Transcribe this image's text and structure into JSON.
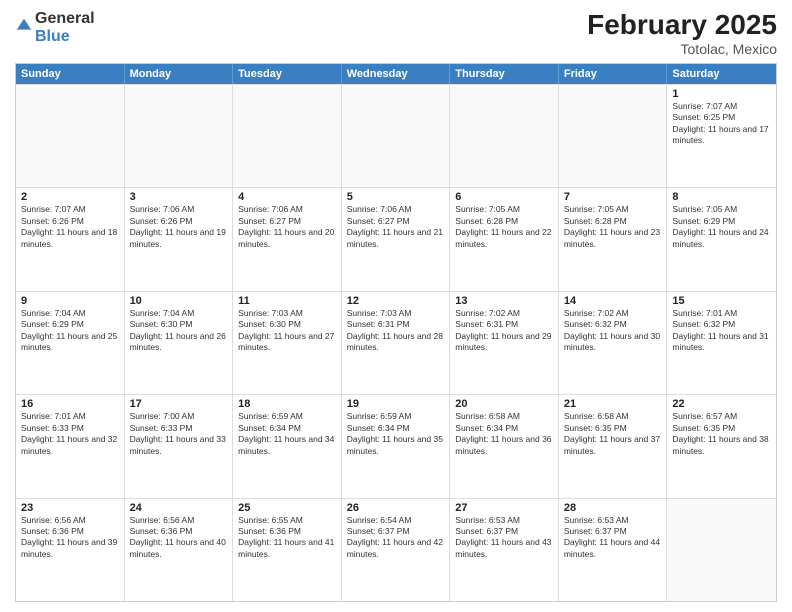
{
  "header": {
    "logo_general": "General",
    "logo_blue": "Blue",
    "month_title": "February 2025",
    "location": "Totolac, Mexico"
  },
  "weekdays": [
    "Sunday",
    "Monday",
    "Tuesday",
    "Wednesday",
    "Thursday",
    "Friday",
    "Saturday"
  ],
  "rows": [
    [
      {
        "day": "",
        "info": ""
      },
      {
        "day": "",
        "info": ""
      },
      {
        "day": "",
        "info": ""
      },
      {
        "day": "",
        "info": ""
      },
      {
        "day": "",
        "info": ""
      },
      {
        "day": "",
        "info": ""
      },
      {
        "day": "1",
        "info": "Sunrise: 7:07 AM\nSunset: 6:25 PM\nDaylight: 11 hours and 17 minutes."
      }
    ],
    [
      {
        "day": "2",
        "info": "Sunrise: 7:07 AM\nSunset: 6:26 PM\nDaylight: 11 hours and 18 minutes."
      },
      {
        "day": "3",
        "info": "Sunrise: 7:06 AM\nSunset: 6:26 PM\nDaylight: 11 hours and 19 minutes."
      },
      {
        "day": "4",
        "info": "Sunrise: 7:06 AM\nSunset: 6:27 PM\nDaylight: 11 hours and 20 minutes."
      },
      {
        "day": "5",
        "info": "Sunrise: 7:06 AM\nSunset: 6:27 PM\nDaylight: 11 hours and 21 minutes."
      },
      {
        "day": "6",
        "info": "Sunrise: 7:05 AM\nSunset: 6:28 PM\nDaylight: 11 hours and 22 minutes."
      },
      {
        "day": "7",
        "info": "Sunrise: 7:05 AM\nSunset: 6:28 PM\nDaylight: 11 hours and 23 minutes."
      },
      {
        "day": "8",
        "info": "Sunrise: 7:05 AM\nSunset: 6:29 PM\nDaylight: 11 hours and 24 minutes."
      }
    ],
    [
      {
        "day": "9",
        "info": "Sunrise: 7:04 AM\nSunset: 6:29 PM\nDaylight: 11 hours and 25 minutes."
      },
      {
        "day": "10",
        "info": "Sunrise: 7:04 AM\nSunset: 6:30 PM\nDaylight: 11 hours and 26 minutes."
      },
      {
        "day": "11",
        "info": "Sunrise: 7:03 AM\nSunset: 6:30 PM\nDaylight: 11 hours and 27 minutes."
      },
      {
        "day": "12",
        "info": "Sunrise: 7:03 AM\nSunset: 6:31 PM\nDaylight: 11 hours and 28 minutes."
      },
      {
        "day": "13",
        "info": "Sunrise: 7:02 AM\nSunset: 6:31 PM\nDaylight: 11 hours and 29 minutes."
      },
      {
        "day": "14",
        "info": "Sunrise: 7:02 AM\nSunset: 6:32 PM\nDaylight: 11 hours and 30 minutes."
      },
      {
        "day": "15",
        "info": "Sunrise: 7:01 AM\nSunset: 6:32 PM\nDaylight: 11 hours and 31 minutes."
      }
    ],
    [
      {
        "day": "16",
        "info": "Sunrise: 7:01 AM\nSunset: 6:33 PM\nDaylight: 11 hours and 32 minutes."
      },
      {
        "day": "17",
        "info": "Sunrise: 7:00 AM\nSunset: 6:33 PM\nDaylight: 11 hours and 33 minutes."
      },
      {
        "day": "18",
        "info": "Sunrise: 6:59 AM\nSunset: 6:34 PM\nDaylight: 11 hours and 34 minutes."
      },
      {
        "day": "19",
        "info": "Sunrise: 6:59 AM\nSunset: 6:34 PM\nDaylight: 11 hours and 35 minutes."
      },
      {
        "day": "20",
        "info": "Sunrise: 6:58 AM\nSunset: 6:34 PM\nDaylight: 11 hours and 36 minutes."
      },
      {
        "day": "21",
        "info": "Sunrise: 6:58 AM\nSunset: 6:35 PM\nDaylight: 11 hours and 37 minutes."
      },
      {
        "day": "22",
        "info": "Sunrise: 6:57 AM\nSunset: 6:35 PM\nDaylight: 11 hours and 38 minutes."
      }
    ],
    [
      {
        "day": "23",
        "info": "Sunrise: 6:56 AM\nSunset: 6:36 PM\nDaylight: 11 hours and 39 minutes."
      },
      {
        "day": "24",
        "info": "Sunrise: 6:56 AM\nSunset: 6:36 PM\nDaylight: 11 hours and 40 minutes."
      },
      {
        "day": "25",
        "info": "Sunrise: 6:55 AM\nSunset: 6:36 PM\nDaylight: 11 hours and 41 minutes."
      },
      {
        "day": "26",
        "info": "Sunrise: 6:54 AM\nSunset: 6:37 PM\nDaylight: 11 hours and 42 minutes."
      },
      {
        "day": "27",
        "info": "Sunrise: 6:53 AM\nSunset: 6:37 PM\nDaylight: 11 hours and 43 minutes."
      },
      {
        "day": "28",
        "info": "Sunrise: 6:53 AM\nSunset: 6:37 PM\nDaylight: 11 hours and 44 minutes."
      },
      {
        "day": "",
        "info": ""
      }
    ]
  ]
}
